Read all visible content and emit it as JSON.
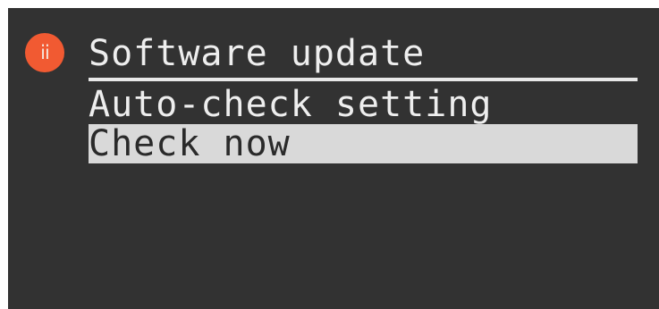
{
  "header": {
    "badge_text": "ii",
    "badge_color": "#f15a32",
    "title": "Software update"
  },
  "menu": {
    "items": [
      {
        "label": "Auto-check setting",
        "selected": false
      },
      {
        "label": "Check now",
        "selected": true
      }
    ]
  },
  "colors": {
    "background": "#323232",
    "text": "#eeeeee",
    "highlight": "#d9d9d9"
  }
}
